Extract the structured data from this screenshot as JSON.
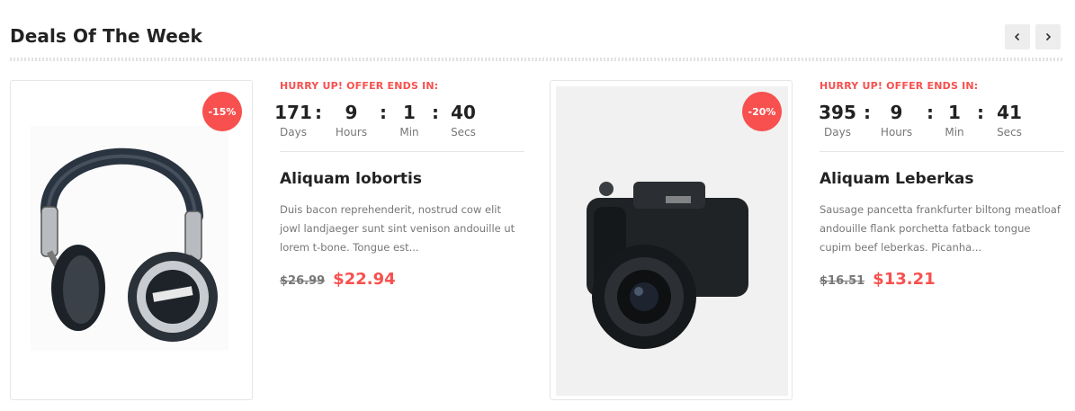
{
  "section": {
    "title": "Deals Of The Week"
  },
  "nav": {
    "prev_icon": "chevron-left-icon",
    "next_icon": "chevron-right-icon"
  },
  "colors": {
    "accent": "#f7504e",
    "text": "#222222",
    "muted": "#777777",
    "border": "#e6e6e6"
  },
  "countdown_labels": {
    "days": "Days",
    "hours": "Hours",
    "min": "Min",
    "secs": "Secs"
  },
  "deals": [
    {
      "badge": "-15%",
      "hurry": "HURRY UP! OFFER ENDS IN:",
      "countdown": {
        "days": "171",
        "hours": "9",
        "min": "1",
        "secs": "40"
      },
      "name": "Aliquam lobortis",
      "description": "Duis bacon reprehenderit, nostrud cow elit jowl landjaeger sunt sint venison andouille ut lorem t-bone. Tongue est...",
      "old_price": "$26.99",
      "new_price": "$22.94",
      "image": "headphones-image"
    },
    {
      "badge": "-20%",
      "hurry": "HURRY UP! OFFER ENDS IN:",
      "countdown": {
        "days": "395",
        "hours": "9",
        "min": "1",
        "secs": "41"
      },
      "name": "Aliquam Leberkas",
      "description": "Sausage pancetta frankfurter biltong meatloaf andouille flank porchetta fatback tongue cupim beef leberkas. Picanha...",
      "old_price": "$16.51",
      "new_price": "$13.21",
      "image": "camera-image"
    }
  ]
}
